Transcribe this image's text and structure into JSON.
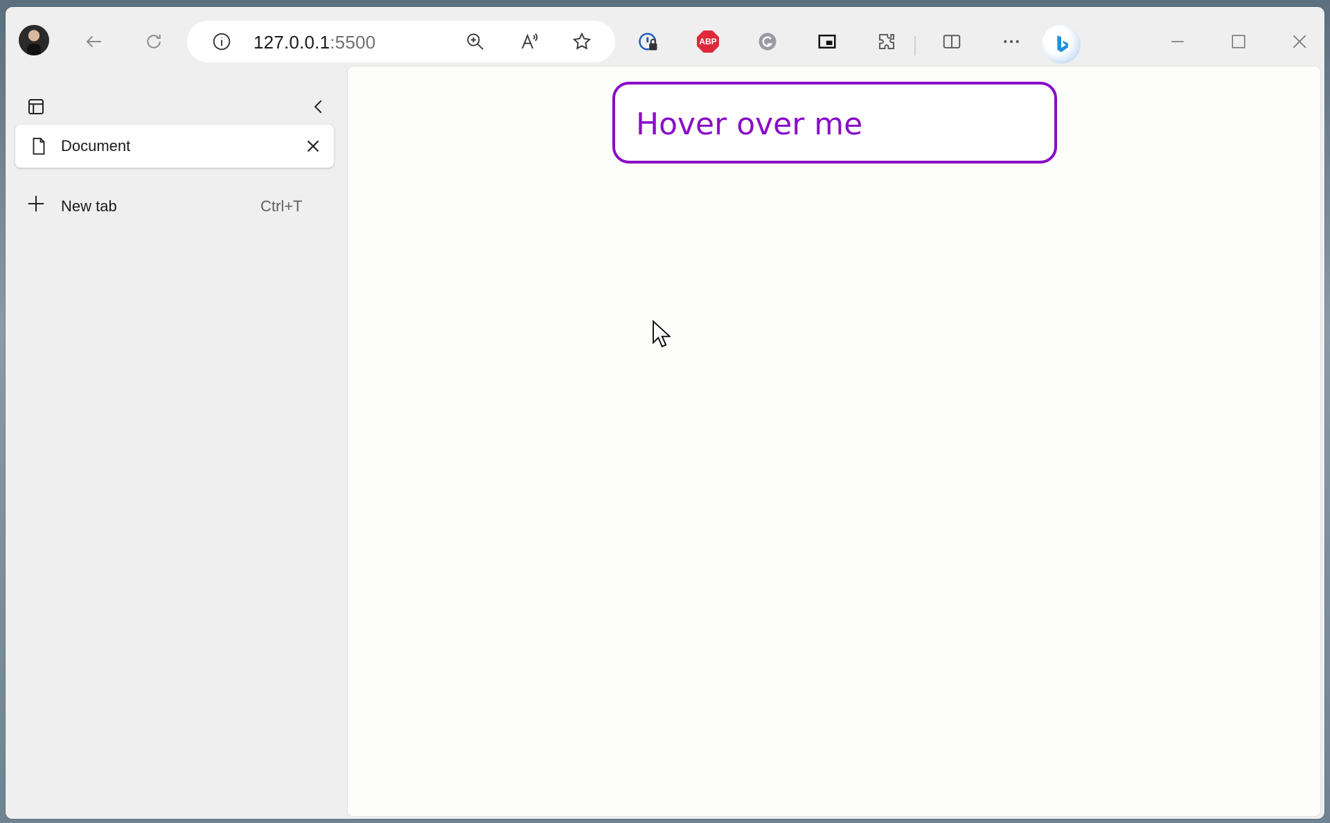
{
  "browser": {
    "address": {
      "host": "127.0.0.1",
      "port": ":5500"
    },
    "toolbar_icons": [
      "back-arrow-icon",
      "refresh-icon",
      "site-info-icon",
      "zoom-in-icon",
      "read-aloud-icon",
      "favorite-star-icon",
      "password-lock-icon",
      "adblock-plus-icon",
      "grammarly-icon",
      "picture-in-picture-icon",
      "extensions-puzzle-icon",
      "split-screen-icon",
      "more-dots-icon",
      "bing-copilot-icon"
    ],
    "abp_label": "ABP"
  },
  "sidebar": {
    "tabs": [
      {
        "label": "Document"
      }
    ],
    "new_tab": {
      "label": "New tab",
      "shortcut": "Ctrl+T"
    }
  },
  "page": {
    "hover_box_text": "Hover over me"
  },
  "colors": {
    "accent_purple": "#8a0dc6",
    "abp_red": "#e0283a"
  }
}
